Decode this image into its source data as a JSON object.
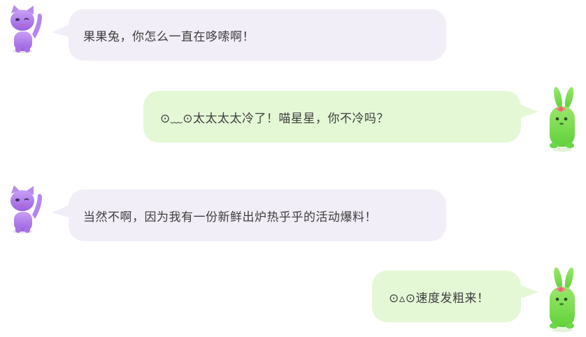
{
  "chat": {
    "messages": [
      {
        "sender": "cat",
        "text": "果果兔，你怎么一直在哆嗦啊！"
      },
      {
        "sender": "rabbit",
        "text": "⊙﹏⊙太太太太冷了！喵星星，你不冷吗？"
      },
      {
        "sender": "cat",
        "text": "当然不啊，因为我有一份新鲜出炉热乎乎的活动爆料！"
      },
      {
        "sender": "rabbit",
        "text": "⊙▵⊙速度发粗来！"
      }
    ]
  },
  "colors": {
    "cat_bubble": "#f1eef8",
    "rabbit_bubble": "#e4f8d6",
    "text": "#3d3d3d"
  }
}
